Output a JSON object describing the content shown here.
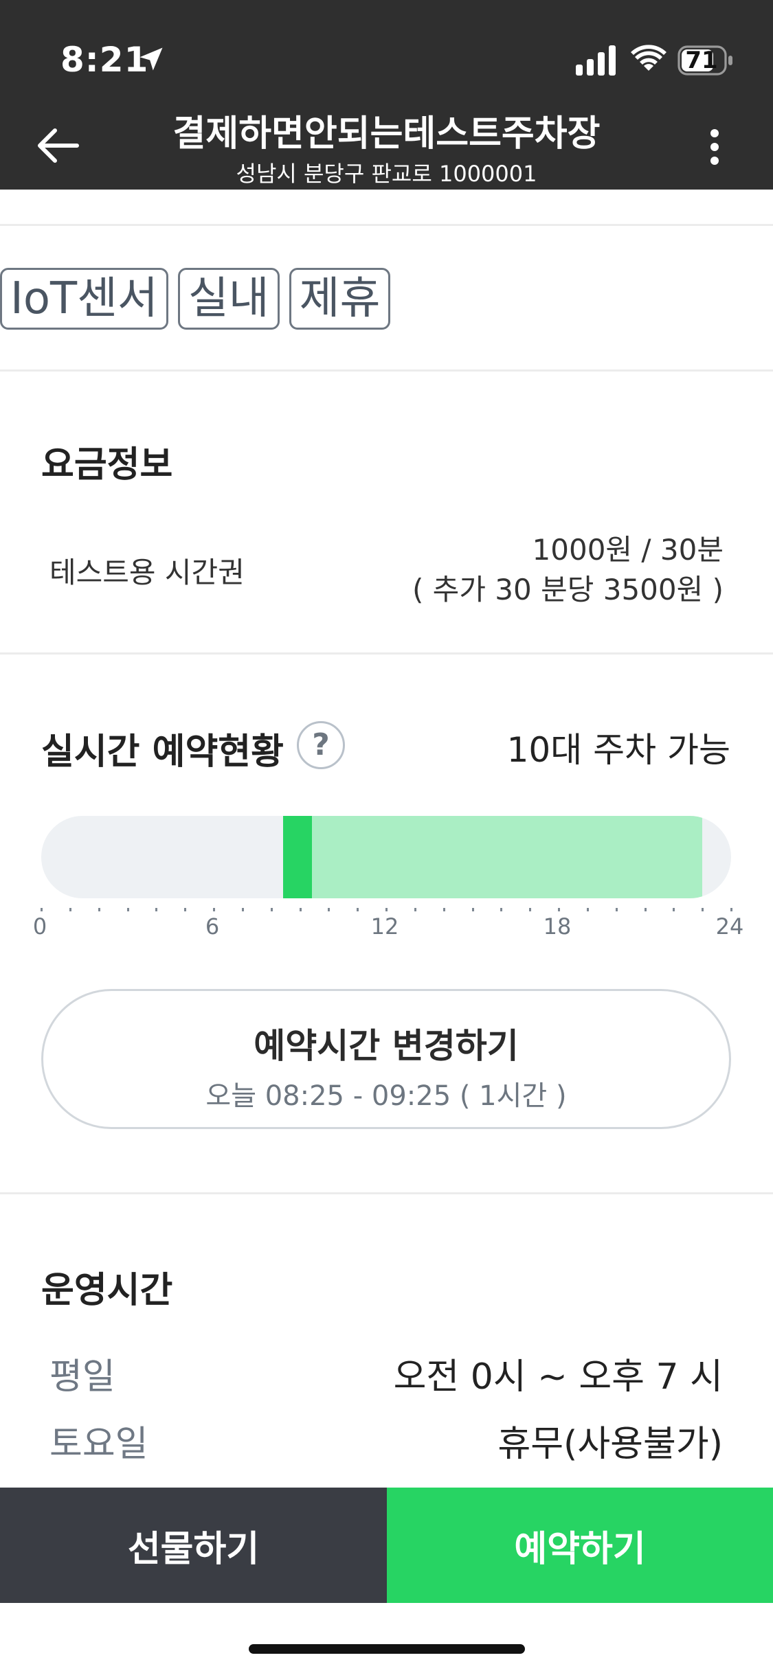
{
  "status_bar": {
    "time": "8:21",
    "battery": "71"
  },
  "header": {
    "title": "결제하면안되는테스트주차장",
    "subtitle": "성남시 분당구 판교로 1000001"
  },
  "tags": [
    "IoT센서",
    "실내",
    "제휴"
  ],
  "fee": {
    "section_title": "요금정보",
    "item_name": "테스트용 시간권",
    "price": "1000원 / 30분",
    "extra": "( 추가 30 분당 3500원 )"
  },
  "realtime": {
    "section_title": "실시간 예약현황",
    "help_label": "?",
    "availability": "10대 주차 가능",
    "tick_labels": [
      "0",
      "6",
      "12",
      "18",
      "24"
    ],
    "timeline": {
      "range_hours": [
        0,
        24
      ],
      "available_window": [
        8.417,
        23.0
      ],
      "selected_window": [
        8.417,
        9.417
      ],
      "colors": {
        "track": "#eef1f4",
        "available": "#aaeec4",
        "selected": "#27d463"
      }
    }
  },
  "change_time": {
    "title": "예약시간 변경하기",
    "subtitle": "오늘 08:25 - 09:25 ( 1시간 )"
  },
  "hours": {
    "section_title": "운영시간",
    "rows": [
      {
        "day": "평일",
        "value": "오전 0시 ~ 오후 7 시"
      },
      {
        "day": "토요일",
        "value": "휴무(사용불가)"
      }
    ]
  },
  "bottom": {
    "gift_label": "선물하기",
    "reserve_label": "예약하기"
  },
  "colors": {
    "header_bg": "#2f2f2f",
    "accent_green": "#27d463",
    "dark_button": "#3a3d44"
  },
  "icons": [
    "location-arrow-icon",
    "cellular-signal-icon",
    "wifi-icon",
    "battery-icon",
    "back-arrow-icon",
    "more-vertical-icon",
    "help-icon"
  ]
}
